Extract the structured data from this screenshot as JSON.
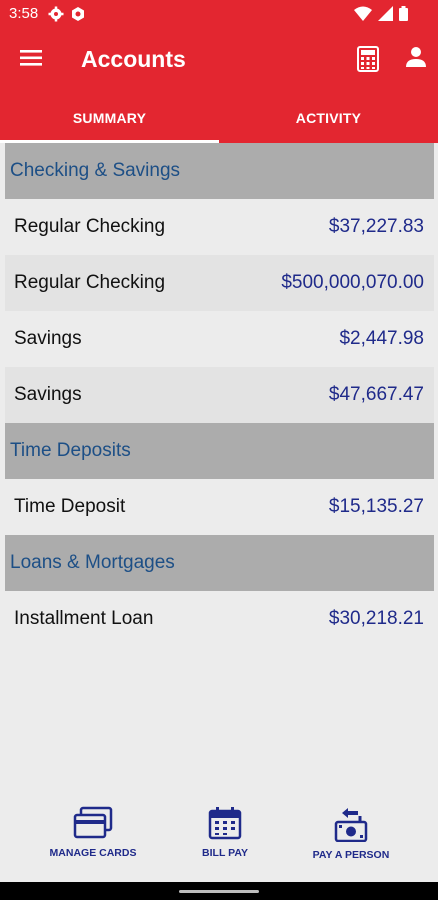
{
  "status": {
    "time": "3:58"
  },
  "appbar": {
    "title": "Accounts"
  },
  "tabs": [
    {
      "label": "SUMMARY",
      "selected": true
    },
    {
      "label": "ACTIVITY",
      "selected": false
    }
  ],
  "sections": [
    {
      "title": "Checking & Savings",
      "rows": [
        {
          "name": "Regular Checking",
          "amount": "$37,227.83"
        },
        {
          "name": "Regular Checking",
          "amount": "$500,000,070.00"
        },
        {
          "name": "Savings",
          "amount": "$2,447.98"
        },
        {
          "name": "Savings",
          "amount": "$47,667.47"
        }
      ]
    },
    {
      "title": "Time Deposits",
      "rows": [
        {
          "name": "Time Deposit",
          "amount": "$15,135.27"
        }
      ]
    },
    {
      "title": "Loans & Mortgages",
      "rows": [
        {
          "name": "Installment Loan",
          "amount": "$30,218.21"
        }
      ]
    }
  ],
  "bottom_nav": [
    {
      "label": "MANAGE CARDS",
      "icon": "card-icon"
    },
    {
      "label": "BILL PAY",
      "icon": "calendar-icon"
    },
    {
      "label": "PAY A PERSON",
      "icon": "pay-person-icon"
    }
  ],
  "colors": {
    "primary": "#e32630",
    "accent": "#1f2a8a",
    "header": "#1d4f86",
    "section_bg": "#acacac"
  }
}
